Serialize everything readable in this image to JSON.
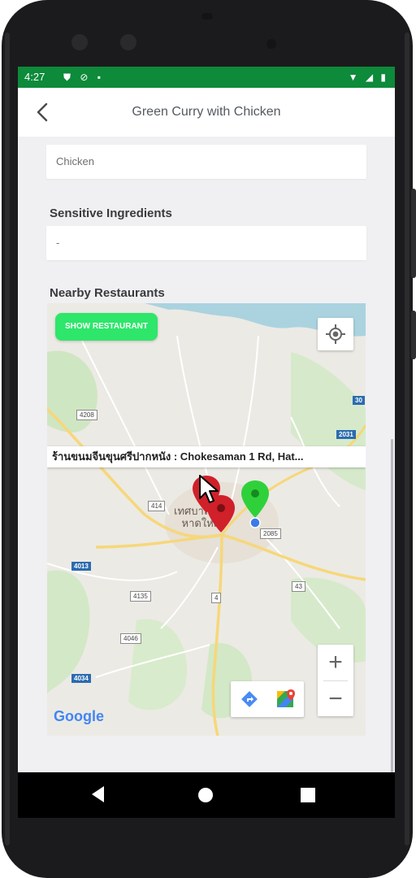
{
  "status_bar": {
    "time": "4:27",
    "left_icons": [
      "shield-icon",
      "data-saver-icon",
      "lock-icon"
    ],
    "right_icons": [
      "wifi-icon",
      "signal-icon",
      "battery-icon"
    ]
  },
  "app_bar": {
    "back_icon": "chevron-left-icon",
    "title": "Green Curry with Chicken"
  },
  "ingredients_field": {
    "value": "Chicken"
  },
  "sensitive_section": {
    "title": "Sensitive Ingredients",
    "value": "-"
  },
  "nearby_section": {
    "title": "Nearby Restaurants"
  },
  "map": {
    "show_button_label": "SHOW RESTAURANT",
    "info_window_text": "ร้านขนมจีนขุนศรีปากหนัง : Chokesaman 1 Rd, Hat...",
    "zoom_in": "+",
    "zoom_out": "−",
    "logo_text": "Google",
    "town_label_line1": "เทศบาลนคร",
    "town_label_line2": "หาดใหญ่",
    "road_labels": [
      "4208",
      "414",
      "4135",
      "4046",
      "4013",
      "4034",
      "2085",
      "43",
      "4",
      "2031",
      "30"
    ],
    "marker_colors": {
      "restaurant": "#d0202a",
      "selected": "#2fd13a",
      "user_location": "#3d7be8"
    },
    "brand_colors": {
      "show_button": "#2ee66a",
      "status_bar": "#0d8a3a"
    }
  },
  "nav_bar": {
    "back": "triangle-back-icon",
    "home": "circle-home-icon",
    "recents": "square-recents-icon"
  }
}
